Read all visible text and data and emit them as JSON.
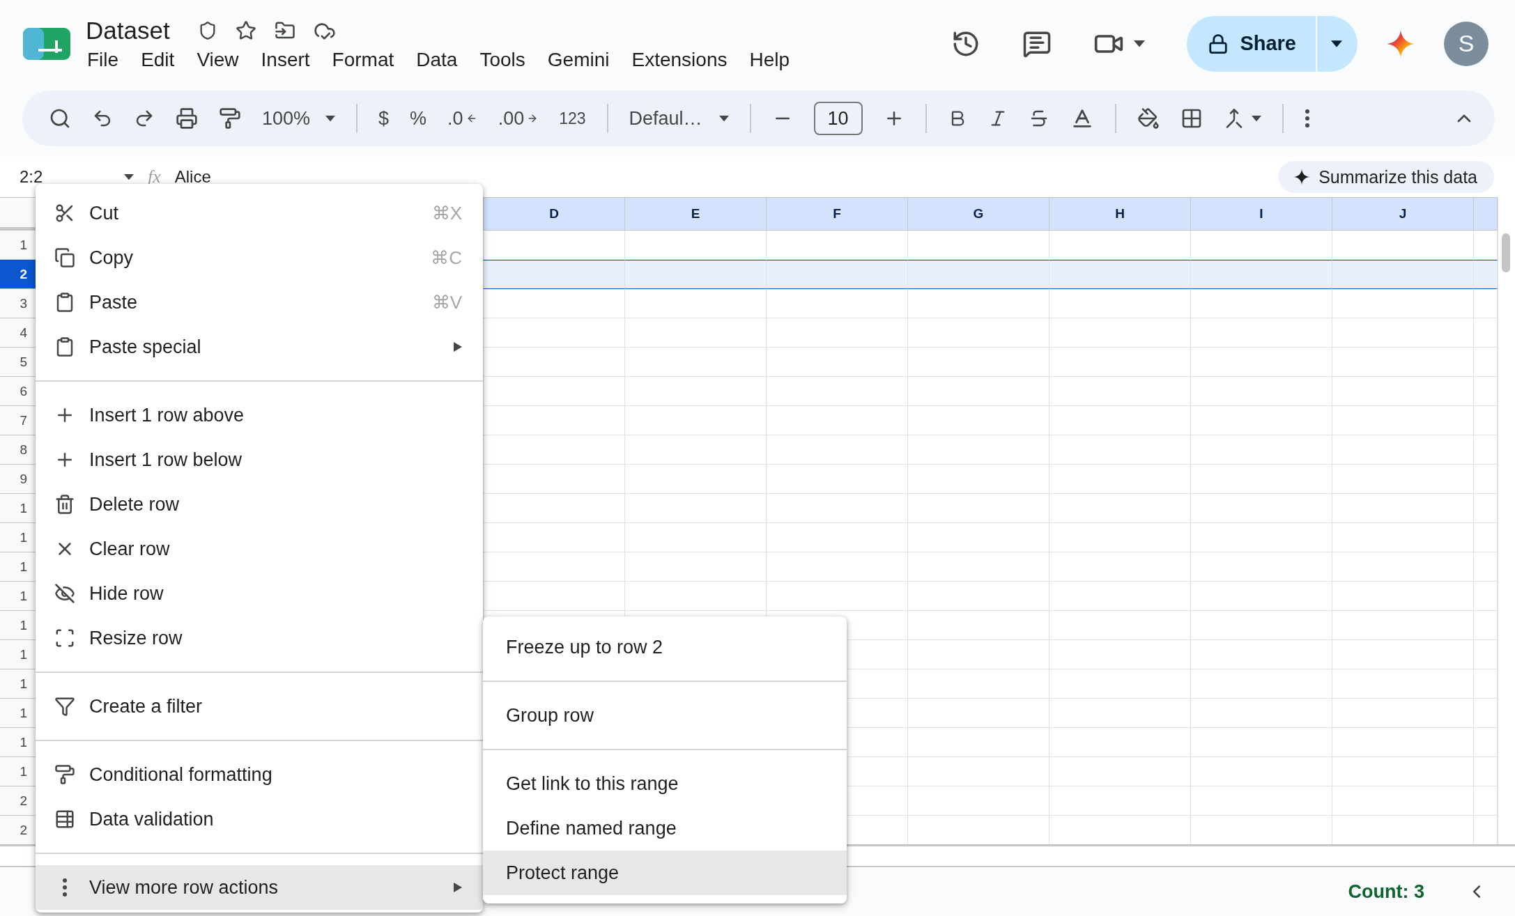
{
  "document": {
    "title": "Dataset"
  },
  "menu_bar": [
    "File",
    "Edit",
    "View",
    "Insert",
    "Format",
    "Data",
    "Tools",
    "Gemini",
    "Extensions",
    "Help"
  ],
  "share": {
    "label": "Share"
  },
  "avatar": {
    "initial": "S"
  },
  "toolbar": {
    "zoom": "100%",
    "currency": "$",
    "percent": "%",
    "decrease_decimal": ".0",
    "increase_decimal": ".00",
    "number_format": "123",
    "font": "Defaul…",
    "font_size": "10"
  },
  "formula_bar": {
    "name_box": "2:2",
    "function_label": "fx",
    "value": "Alice"
  },
  "summarize": {
    "label": "Summarize this data"
  },
  "columns": [
    "D",
    "E",
    "F",
    "G",
    "H",
    "I",
    "J"
  ],
  "rows": [
    {
      "label": "1",
      "selected": false
    },
    {
      "label": "2",
      "selected": true
    },
    {
      "label": "3",
      "selected": false
    },
    {
      "label": "4",
      "selected": false
    },
    {
      "label": "5",
      "selected": false
    },
    {
      "label": "6",
      "selected": false
    },
    {
      "label": "7",
      "selected": false
    },
    {
      "label": "8",
      "selected": false
    },
    {
      "label": "9",
      "selected": false
    },
    {
      "label": "1",
      "selected": false
    },
    {
      "label": "1",
      "selected": false
    },
    {
      "label": "1",
      "selected": false
    },
    {
      "label": "1",
      "selected": false
    },
    {
      "label": "1",
      "selected": false
    },
    {
      "label": "1",
      "selected": false
    },
    {
      "label": "1",
      "selected": false
    },
    {
      "label": "1",
      "selected": false
    },
    {
      "label": "1",
      "selected": false
    },
    {
      "label": "1",
      "selected": false
    },
    {
      "label": "2",
      "selected": false
    },
    {
      "label": "2",
      "selected": false
    }
  ],
  "context_menu": [
    {
      "kind": "item",
      "label": "Cut",
      "shortcut": "⌘X",
      "submenu": false,
      "highlighted": false
    },
    {
      "kind": "item",
      "label": "Copy",
      "shortcut": "⌘C",
      "submenu": false,
      "highlighted": false
    },
    {
      "kind": "item",
      "label": "Paste",
      "shortcut": "⌘V",
      "submenu": false,
      "highlighted": false
    },
    {
      "kind": "item",
      "label": "Paste special",
      "submenu": true,
      "highlighted": false
    },
    {
      "kind": "separator"
    },
    {
      "kind": "item",
      "label": "Insert 1 row above",
      "submenu": false,
      "highlighted": false
    },
    {
      "kind": "item",
      "label": "Insert 1 row below",
      "submenu": false,
      "highlighted": false
    },
    {
      "kind": "item",
      "label": "Delete row",
      "submenu": false,
      "highlighted": false
    },
    {
      "kind": "item",
      "label": "Clear row",
      "submenu": false,
      "highlighted": false
    },
    {
      "kind": "item",
      "label": "Hide row",
      "submenu": false,
      "highlighted": false
    },
    {
      "kind": "item",
      "label": "Resize row",
      "submenu": false,
      "highlighted": false
    },
    {
      "kind": "separator"
    },
    {
      "kind": "item",
      "label": "Create a filter",
      "submenu": false,
      "highlighted": false
    },
    {
      "kind": "separator"
    },
    {
      "kind": "item",
      "label": "Conditional formatting",
      "submenu": false,
      "highlighted": false
    },
    {
      "kind": "item",
      "label": "Data validation",
      "submenu": false,
      "highlighted": false
    },
    {
      "kind": "separator"
    },
    {
      "kind": "item",
      "label": "View more row actions",
      "submenu": true,
      "highlighted": true
    }
  ],
  "submenu": [
    {
      "kind": "item",
      "label": "Freeze up to row 2",
      "highlighted": false
    },
    {
      "kind": "separator"
    },
    {
      "kind": "item",
      "label": "Group row",
      "highlighted": false
    },
    {
      "kind": "separator"
    },
    {
      "kind": "item",
      "label": "Get link to this range",
      "highlighted": false
    },
    {
      "kind": "item",
      "label": "Define named range",
      "highlighted": false
    },
    {
      "kind": "item",
      "label": "Protect range",
      "highlighted": true
    }
  ],
  "status_bar": {
    "summary": "Count: 3"
  }
}
